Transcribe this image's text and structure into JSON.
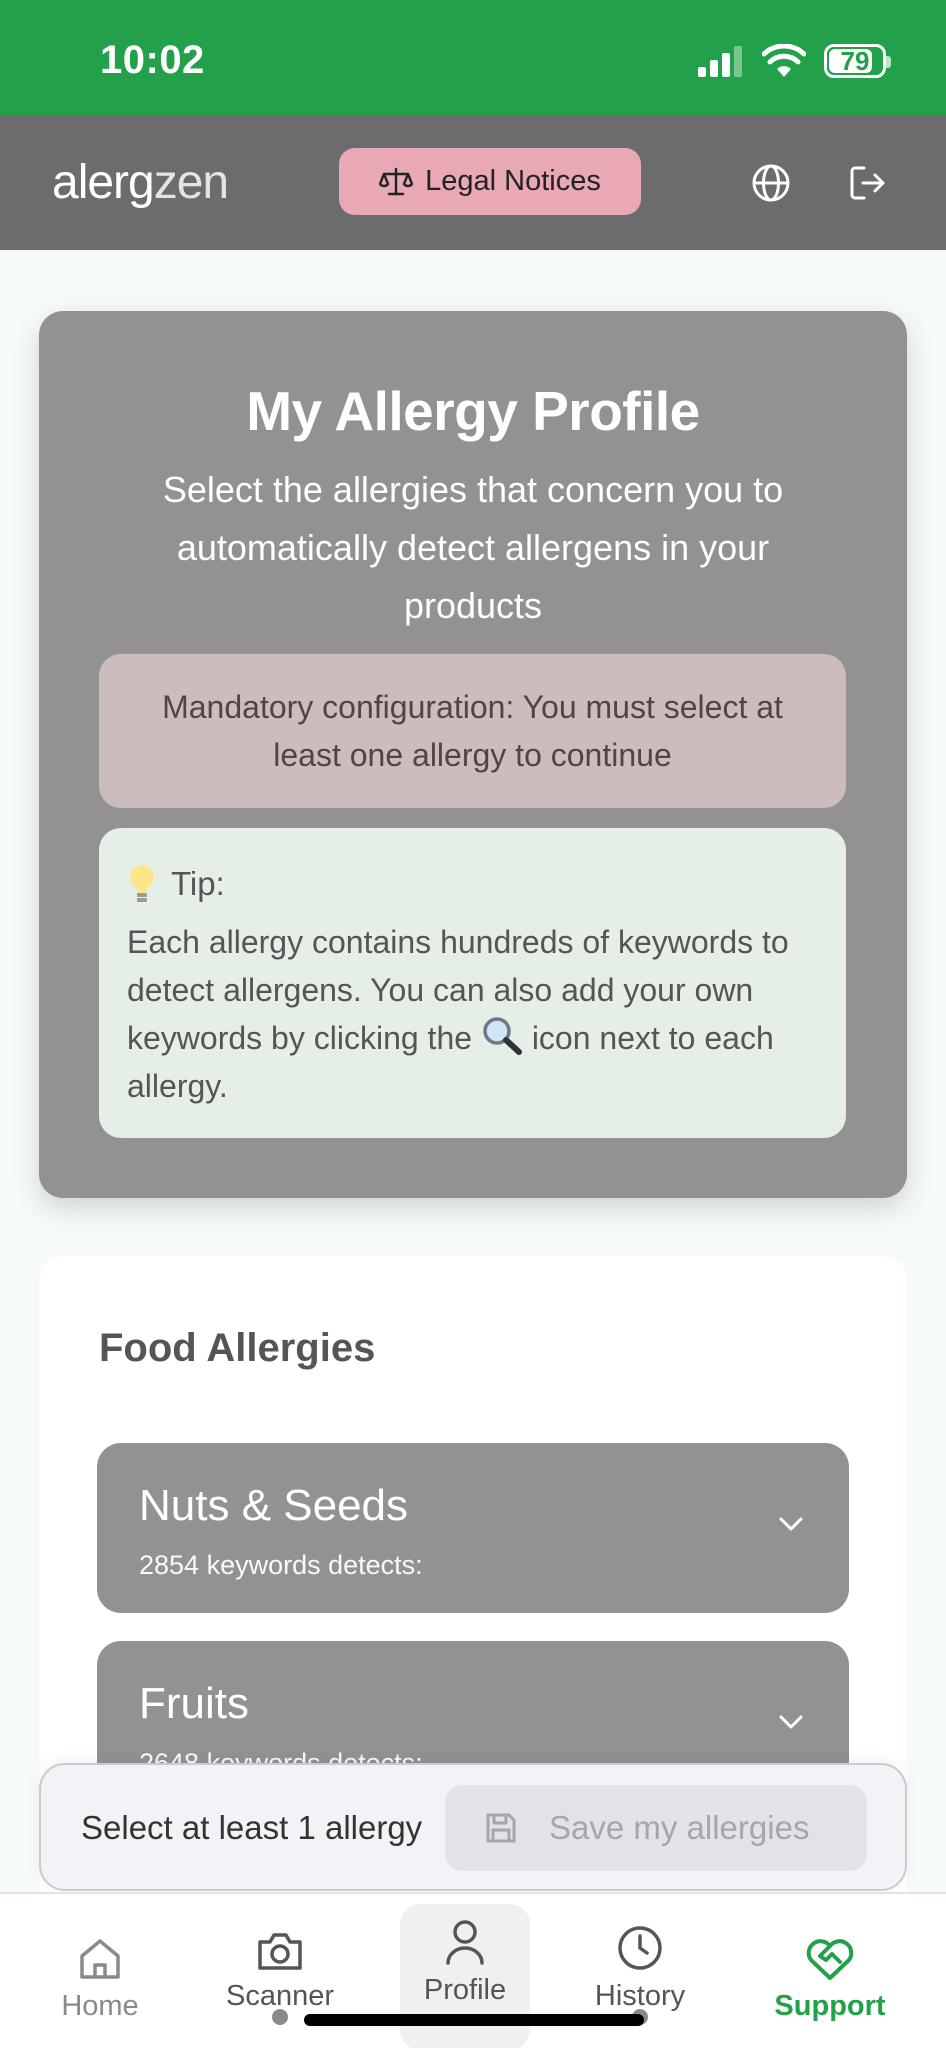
{
  "status_bar": {
    "time": "10:02",
    "battery": "79"
  },
  "header": {
    "logo_part1": "alerg",
    "logo_part2": "zen",
    "legal_label": "Legal Notices"
  },
  "profile": {
    "title": "My Allergy Profile",
    "subtitle": "Select the allergies that concern you to automatically detect allergens in your products",
    "mandatory": "Mandatory configuration: You must select at least one allergy to continue",
    "tip_label": "Tip:",
    "tip_text_before": "Each allergy contains hundreds of keywords to detect allergens. You can also add your own keywords by clicking the ",
    "tip_text_after": " icon next to each allergy."
  },
  "food": {
    "section_title": "Food Allergies",
    "items": [
      {
        "name": "Nuts & Seeds",
        "count": "2854 keywords detects:"
      },
      {
        "name": "Fruits",
        "count": "2648 keywords detects:"
      }
    ]
  },
  "save_bar": {
    "hint": "Select at least 1 allergy",
    "save_label": "Save my allergies"
  },
  "nav": [
    {
      "label": "Home",
      "icon": "home-icon"
    },
    {
      "label": "Scanner",
      "icon": "camera-icon"
    },
    {
      "label": "Profile",
      "icon": "user-icon"
    },
    {
      "label": "History",
      "icon": "clock-icon"
    },
    {
      "label": "Support",
      "icon": "heart-handshake-icon"
    }
  ],
  "colors": {
    "status_bar": "#22a04a",
    "header": "#6c6c6e",
    "legal_button": "#e8a9b5",
    "card": "#929292",
    "mandatory_box": "#cdbcbc",
    "tip_box": "#e5efe6",
    "support_active": "#22a04a"
  }
}
